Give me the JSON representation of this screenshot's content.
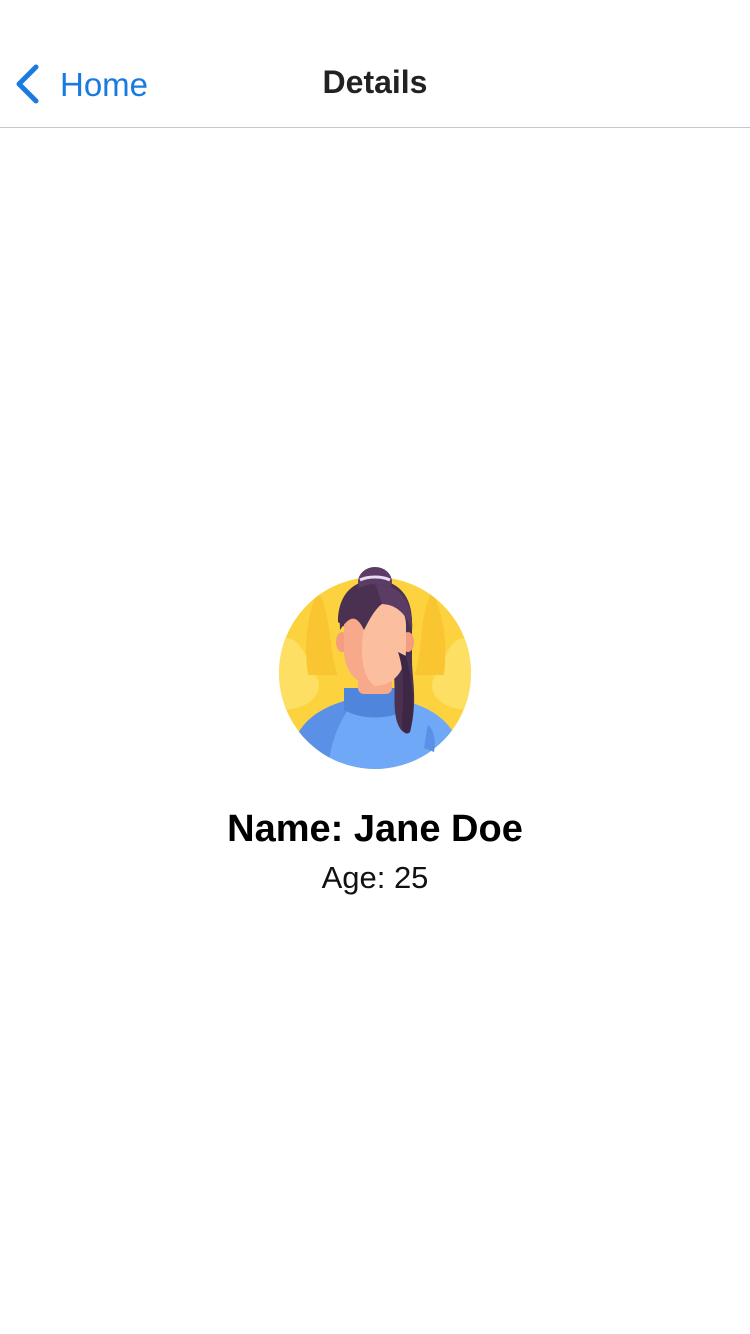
{
  "nav": {
    "back_label": "Home",
    "title": "Details",
    "accent": "#1a7ae2"
  },
  "profile": {
    "avatar_icon": "woman-avatar-icon",
    "name": "Name: Jane Doe",
    "age": "Age: 25"
  }
}
